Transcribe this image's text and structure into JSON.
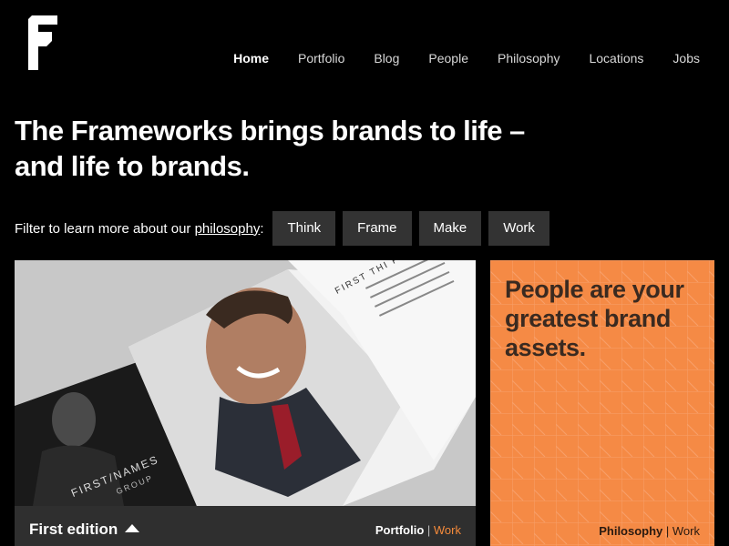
{
  "brand": {
    "logo_icon": "frameworks-f-logo"
  },
  "nav": {
    "items": [
      {
        "label": "Home",
        "active": true
      },
      {
        "label": "Portfolio"
      },
      {
        "label": "Blog"
      },
      {
        "label": "People"
      },
      {
        "label": "Philosophy"
      },
      {
        "label": "Locations"
      },
      {
        "label": "Jobs"
      }
    ]
  },
  "hero": {
    "line1": "The Frameworks brings brands to life –",
    "line2": "and life to brands."
  },
  "filter": {
    "prefix": "Filter to learn more about our ",
    "link": "philosophy",
    "suffix": ":",
    "buttons": [
      "Think",
      "Frame",
      "Make",
      "Work"
    ]
  },
  "card_left": {
    "title": "First edition",
    "tag1": "Portfolio",
    "sep": " | ",
    "tag2": "Work",
    "brochure_text": "FIRST/NAMES",
    "brochure_sub": "GROUP",
    "page_text": "FIRST THI FIRST"
  },
  "card_right": {
    "headline": "People are your greatest brand assets.",
    "tag1": "Philosophy",
    "sep": " | ",
    "tag2": "Work",
    "accent": "#f58a45"
  }
}
